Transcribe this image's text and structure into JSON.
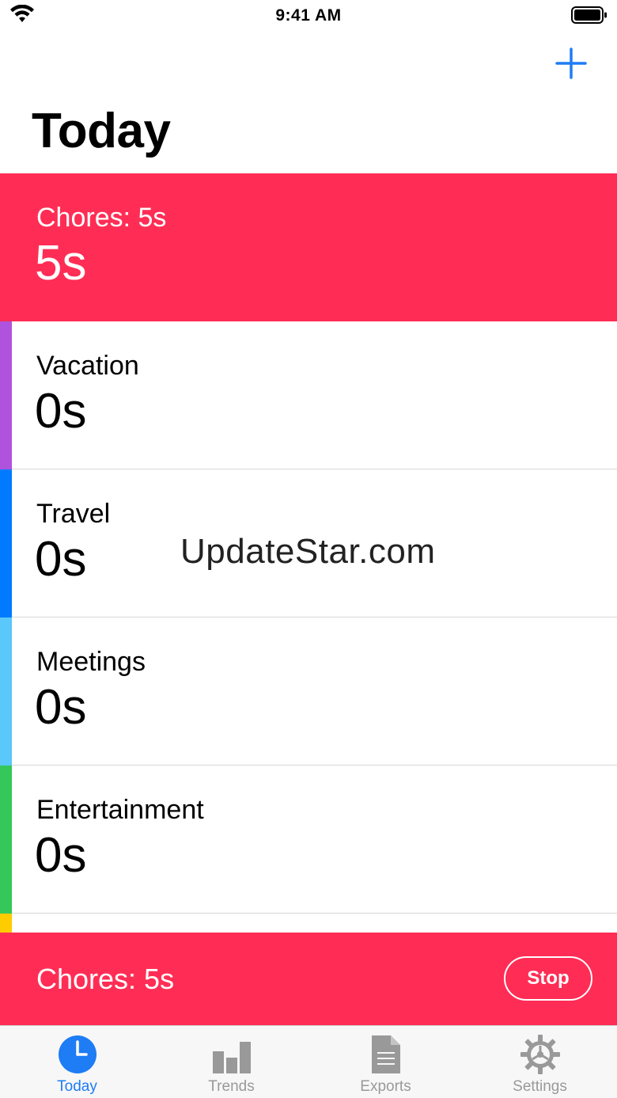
{
  "status_bar": {
    "time": "9:41 AM"
  },
  "header": {
    "title": "Today",
    "add_icon": "plus-icon"
  },
  "rows": [
    {
      "name": "Chores: 5s",
      "time": "5s",
      "color": "#ff2d55",
      "active": true
    },
    {
      "name": "Vacation",
      "time": "0s",
      "color": "#af52de",
      "active": false
    },
    {
      "name": "Travel",
      "time": "0s",
      "color": "#007aff",
      "active": false
    },
    {
      "name": "Meetings",
      "time": "0s",
      "color": "#5ac8fa",
      "active": false
    },
    {
      "name": "Entertainment",
      "time": "0s",
      "color": "#34c759",
      "active": false
    },
    {
      "name": "",
      "time": "",
      "color": "#ffcc00",
      "active": false
    }
  ],
  "watermark": "UpdateStar.com",
  "running": {
    "label": "Chores: 5s",
    "stop_label": "Stop",
    "color": "#ff2d55"
  },
  "tabs": [
    {
      "label": "Today",
      "icon": "clock-icon",
      "selected": true
    },
    {
      "label": "Trends",
      "icon": "bar-chart-icon",
      "selected": false
    },
    {
      "label": "Exports",
      "icon": "document-icon",
      "selected": false
    },
    {
      "label": "Settings",
      "icon": "gear-icon",
      "selected": false
    }
  ],
  "colors": {
    "accent": "#1e7cf5",
    "inactive_tab": "#999999"
  }
}
